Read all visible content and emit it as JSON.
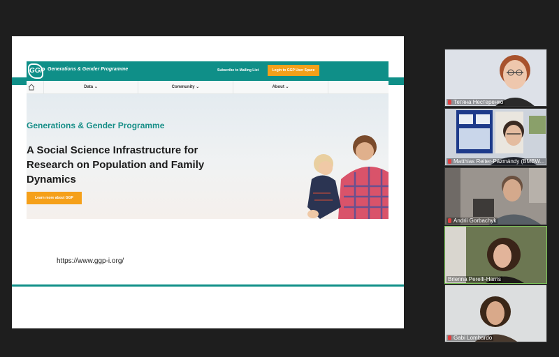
{
  "site": {
    "brand": "Generations & Gender Programme",
    "logo_text": "GGP",
    "subscribe_label": "Subscribe to Mailing List",
    "login_label": "Login to GGP User Space",
    "nav": [
      "Data ⌄",
      "Community ⌄",
      "About ⌄"
    ],
    "hero_subtitle": "Generations & Gender Programme",
    "hero_title": "A Social Science Infrastructure for Research on Population and Family Dynamics",
    "hero_button": "Learn more about GGP"
  },
  "slide": {
    "url": "https://www.ggp-i.org/"
  },
  "participants": [
    {
      "name": "Тетяна Нестеренко"
    },
    {
      "name": "Matthias Reiter-Pázmándy (BMBW..."
    },
    {
      "name": "Andrii Gorbachyk"
    },
    {
      "name": "Brienna Perelli-Harris"
    },
    {
      "name": "Gabi Lombardo"
    }
  ],
  "colors": {
    "brand_teal": "#0f8f88",
    "accent_orange": "#f5a01a",
    "mic_muted": "#e04040"
  }
}
